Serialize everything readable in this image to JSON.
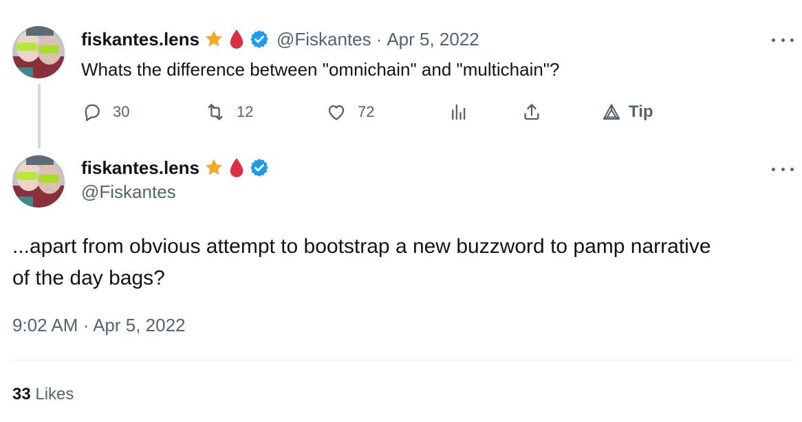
{
  "first_tweet": {
    "display_name": "fiskantes.lens",
    "handle": "@Fiskantes",
    "separator": "·",
    "date": "Apr 5, 2022",
    "text": "Whats the difference between \"omnichain\" and \"multichain\"?",
    "badges": [
      "star-emoji",
      "blood-drop-emoji",
      "verified-badge-icon"
    ],
    "actions": {
      "replies": "30",
      "retweets": "12",
      "likes": "72",
      "tip_label": "Tip"
    }
  },
  "main_tweet": {
    "display_name": "fiskantes.lens",
    "handle": "@Fiskantes",
    "badges": [
      "star-emoji",
      "blood-drop-emoji",
      "verified-badge-icon"
    ],
    "text_line1": "...apart from obvious attempt to bootstrap a new buzzword to pamp narrative",
    "text_line2": "of the day bags?",
    "timestamp": "9:02 AM · Apr 5, 2022",
    "likes_count": "33",
    "likes_label": "Likes"
  },
  "colors": {
    "text_primary": "#0f1419",
    "text_secondary": "#536471",
    "verified_blue": "#1d9bf0",
    "star_gold": "#f4a927",
    "drop_red": "#dd2e44",
    "thread_line": "#cfd9de"
  }
}
